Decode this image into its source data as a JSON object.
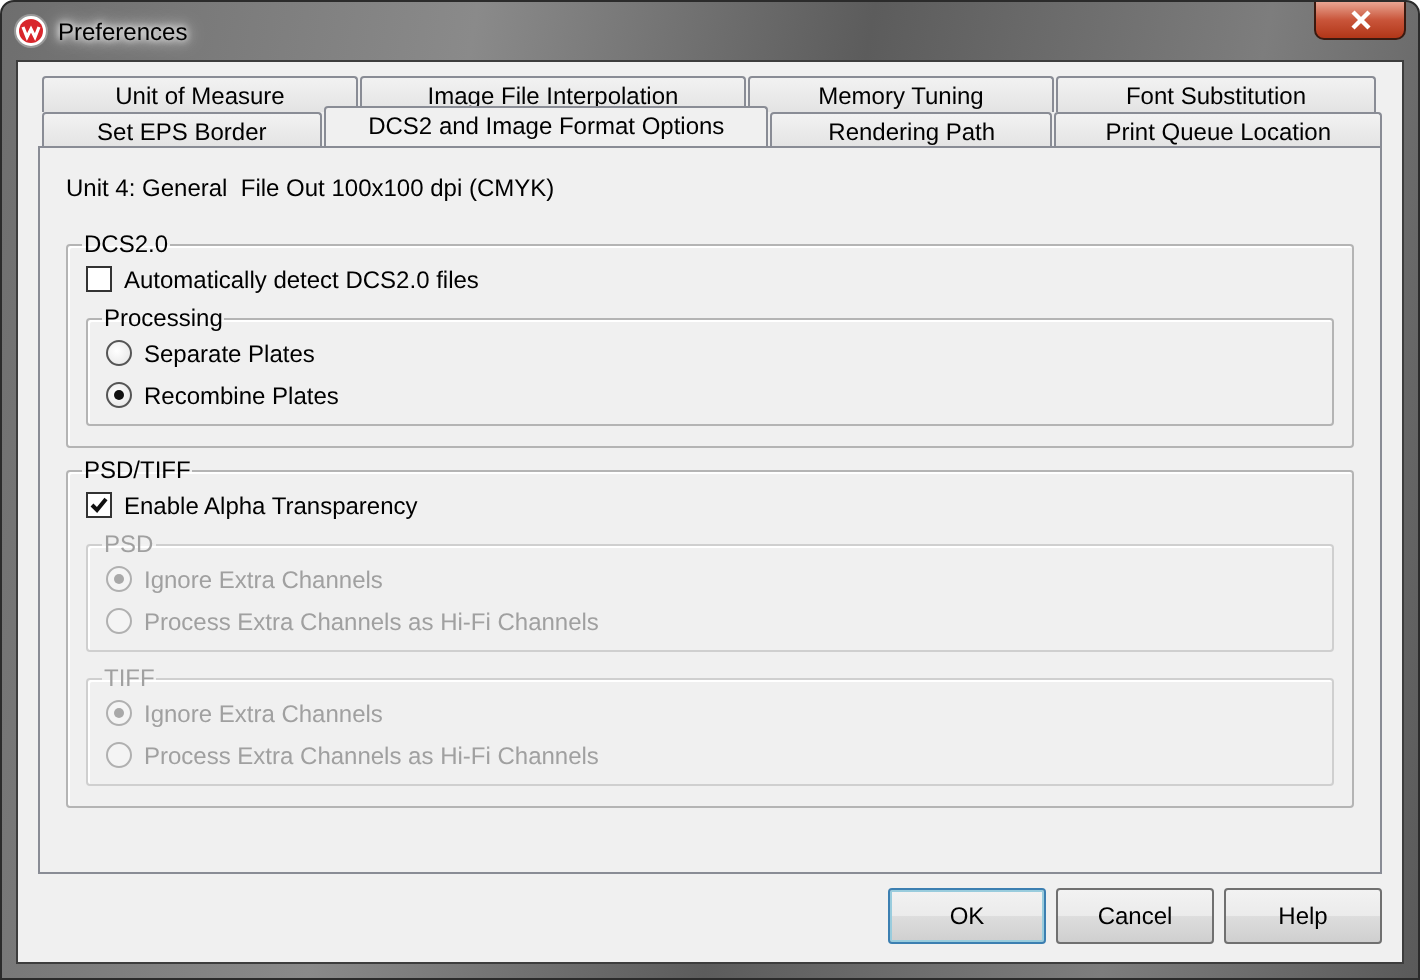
{
  "window": {
    "title": "Preferences"
  },
  "tab_rows": [
    [
      {
        "label": "Unit of Measure",
        "selected": false
      },
      {
        "label": "Image File Interpolation",
        "selected": false
      },
      {
        "label": "Memory Tuning",
        "selected": false
      },
      {
        "label": "Font Substitution",
        "selected": false
      }
    ],
    [
      {
        "label": "Set EPS Border",
        "selected": false
      },
      {
        "label": "DCS2 and Image Format Options",
        "selected": true
      },
      {
        "label": "Rendering Path",
        "selected": false
      },
      {
        "label": "Print Queue Location",
        "selected": false
      }
    ]
  ],
  "info": "Unit 4: General  File Out 100x100 dpi (CMYK)",
  "groups": [
    {
      "title": "DCS2.0",
      "disabled": false,
      "items": [
        {
          "kind": "checkbox",
          "label": "Automatically detect DCS2.0 files",
          "checked": false
        },
        {
          "kind": "group",
          "title": "Processing",
          "disabled": false,
          "items": [
            {
              "kind": "radio",
              "label": "Separate Plates",
              "selected": false
            },
            {
              "kind": "radio",
              "label": "Recombine Plates",
              "selected": true
            }
          ]
        }
      ]
    },
    {
      "title": "PSD/TIFF",
      "disabled": false,
      "items": [
        {
          "kind": "checkbox",
          "label": "Enable Alpha Transparency",
          "checked": true
        },
        {
          "kind": "group",
          "title": "PSD",
          "disabled": true,
          "items": [
            {
              "kind": "radio",
              "label": "Ignore Extra Channels",
              "selected": true
            },
            {
              "kind": "radio",
              "label": "Process Extra Channels as Hi-Fi Channels",
              "selected": false
            }
          ]
        },
        {
          "kind": "group",
          "title": "TIFF",
          "disabled": true,
          "items": [
            {
              "kind": "radio",
              "label": "Ignore Extra Channels",
              "selected": true
            },
            {
              "kind": "radio",
              "label": "Process Extra Channels as Hi-Fi Channels",
              "selected": false
            }
          ]
        }
      ]
    }
  ],
  "buttons": [
    {
      "label": "OK",
      "default": true
    },
    {
      "label": "Cancel",
      "default": false
    },
    {
      "label": "Help",
      "default": false
    }
  ]
}
